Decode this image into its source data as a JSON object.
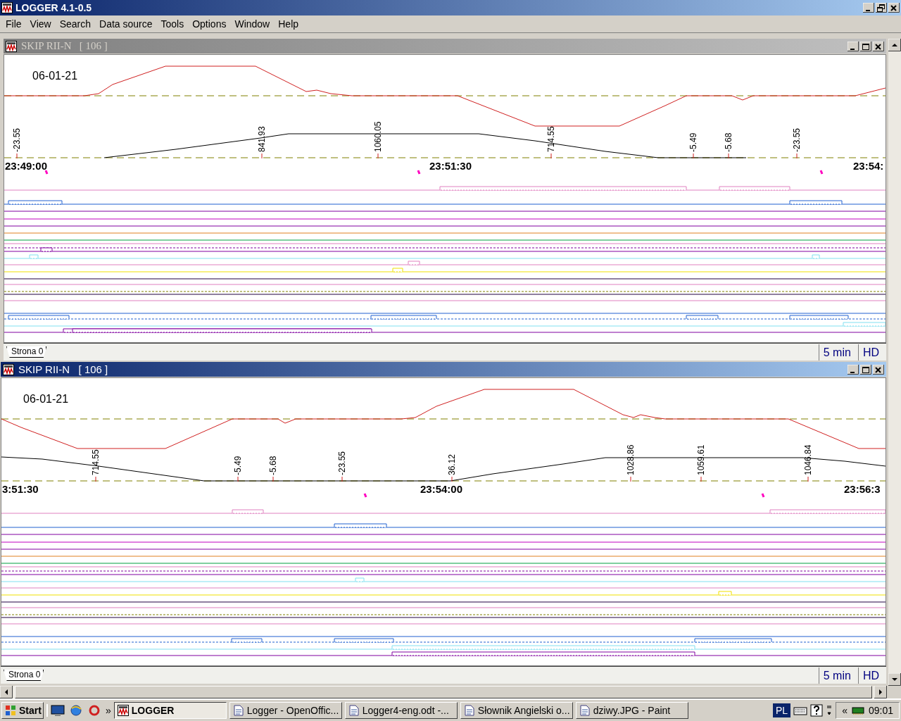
{
  "app": {
    "title": "LOGGER 4.1-0.5"
  },
  "menu": [
    "File",
    "View",
    "Search",
    "Data source",
    "Tools",
    "Options",
    "Window",
    "Help"
  ],
  "windows": [
    {
      "title": "SKIP RII-N   [ 106 ]",
      "active": false,
      "date": "06-01-21",
      "value_labels": [
        "-23.55",
        "841.93",
        "1060.05",
        "714.55",
        "-5.49",
        "-5.68",
        "-23.55"
      ],
      "time_labels": [
        "23:49:00",
        "23:51:30",
        "23:54:"
      ],
      "page_tab": "Strona 0",
      "interval": "5 min",
      "mode": "HD"
    },
    {
      "title": "SKIP RII-N   [ 106 ]",
      "active": true,
      "date": "06-01-21",
      "value_labels": [
        "714.55",
        "-5.49",
        "-5.68",
        "-23.55",
        "36.12",
        "1028.86",
        "1059.61",
        "1046.84"
      ],
      "time_labels": [
        "3:51:30",
        "23:54:00",
        "23:56:3"
      ],
      "page_tab": "Strona 0",
      "interval": "5 min",
      "mode": "HD"
    }
  ],
  "taskbar": {
    "start": "Start",
    "more": "»",
    "tasks": [
      {
        "label": "LOGGER",
        "selected": true
      },
      {
        "label": "Logger - OpenOffic...",
        "selected": false
      },
      {
        "label": "Logger4-eng.odt -...",
        "selected": false
      },
      {
        "label": "Słownik Angielski o...",
        "selected": false
      },
      {
        "label": "dziwy.JPG - Paint",
        "selected": false
      }
    ],
    "language": "PL",
    "tray_expand": "«",
    "clock": "09:01"
  }
}
